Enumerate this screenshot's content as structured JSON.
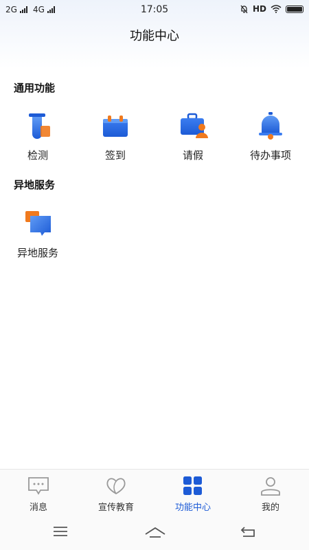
{
  "status_bar": {
    "network1": "2G",
    "network2": "4G",
    "time": "17:05",
    "hd": "HD"
  },
  "page_title": "功能中心",
  "sections": [
    {
      "title": "通用功能",
      "items": [
        {
          "label": "检测",
          "icon": "test-tube-icon"
        },
        {
          "label": "签到",
          "icon": "calendar-icon"
        },
        {
          "label": "请假",
          "icon": "briefcase-person-icon"
        },
        {
          "label": "待办事项",
          "icon": "bell-icon"
        }
      ]
    },
    {
      "title": "异地服务",
      "items": [
        {
          "label": "异地服务",
          "icon": "chat-bubbles-icon"
        }
      ]
    }
  ],
  "tabbar": [
    {
      "label": "消息",
      "icon": "message-icon"
    },
    {
      "label": "宣传教育",
      "icon": "leaf-heart-icon"
    },
    {
      "label": "功能中心",
      "icon": "grid-icon",
      "active": true
    },
    {
      "label": "我的",
      "icon": "person-icon"
    }
  ],
  "colors": {
    "accent": "#1d5bd6",
    "orange": "#f07a1e"
  }
}
